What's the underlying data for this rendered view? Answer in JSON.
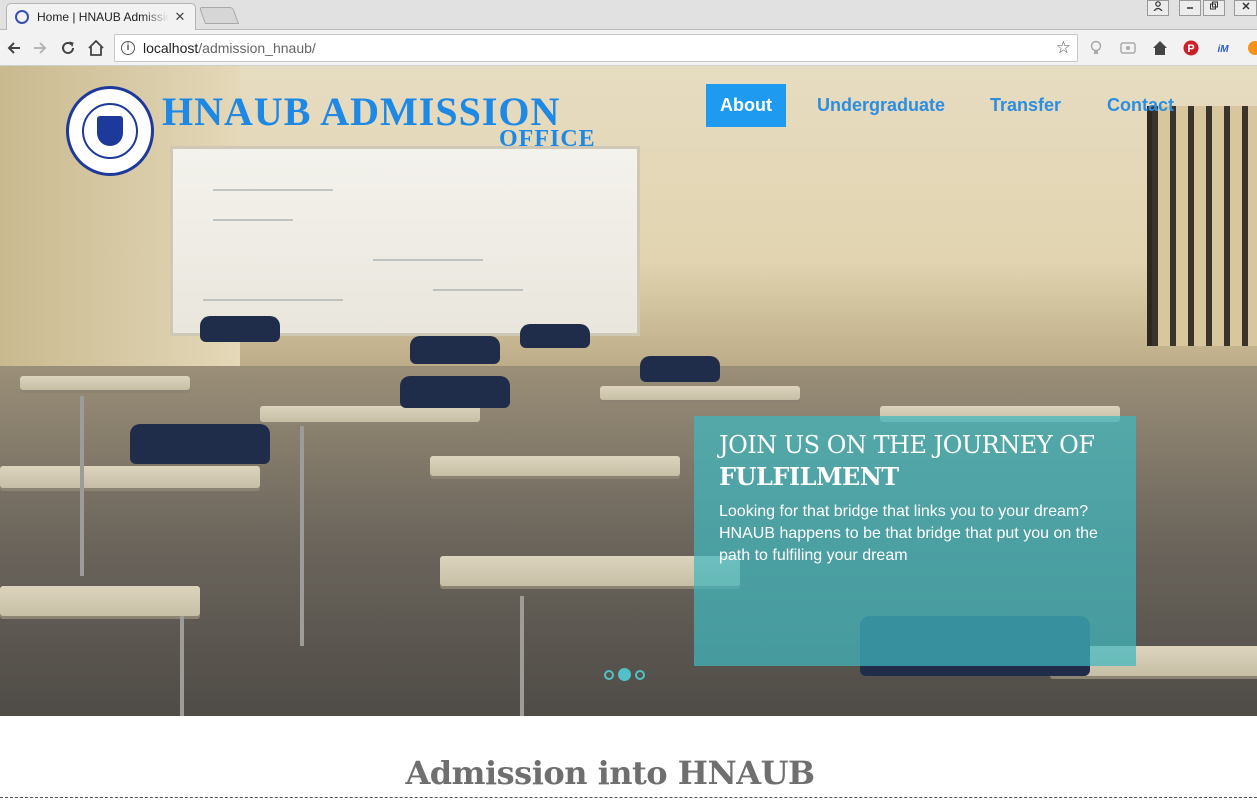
{
  "browser": {
    "tab_title": "Home | HNAUB Admission",
    "tab_close_glyph": "✕",
    "url_host": "localhost",
    "url_path": "/admission_hnaub/"
  },
  "site": {
    "brand_title": "HNAUB ADMISSION",
    "brand_subtitle": "OFFICE",
    "nav": [
      {
        "label": "About",
        "active": true
      },
      {
        "label": "Undergraduate",
        "active": false
      },
      {
        "label": "Transfer",
        "active": false
      },
      {
        "label": "Contact",
        "active": false
      }
    ]
  },
  "hero": {
    "heading_line1": "JOIN US ON THE JOURNEY OF",
    "heading_line2": "FULFILMENT",
    "body": "Looking for that bridge that links you to your dream? HNAUB happens to be that bridge that put you on the path to fulfiling your dream",
    "slide_count": 3,
    "active_slide": 2
  },
  "main": {
    "section_title": "Admission into HNAUB"
  },
  "colors": {
    "brand_blue": "#1e88e5",
    "nav_active_bg": "#1e9bf0",
    "caption_teal": "#40b7be"
  },
  "icons": [
    "back-icon",
    "forward-icon",
    "reload-icon",
    "home-icon",
    "info-icon",
    "star-icon",
    "lightbulb-icon",
    "extension-icon",
    "home-ext-icon",
    "pinterest-icon",
    "imacros-icon",
    "bitcoin-icon",
    "user-icon"
  ]
}
